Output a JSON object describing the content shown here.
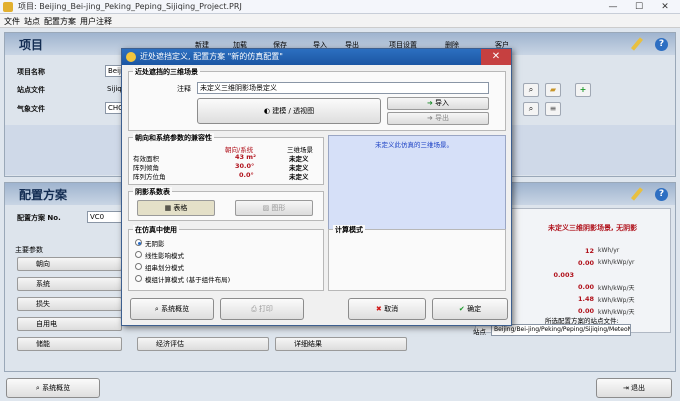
{
  "window": {
    "title": "项目: Beijing_Bei-jing_Peking_Peping_Sijiqing_Project.PRJ"
  },
  "menu": [
    "文件",
    "站点",
    "配置方案",
    "用户注释"
  ],
  "project": {
    "section_title": "项目",
    "toolbar": {
      "new": "新建",
      "load": "加载",
      "save": "保存",
      "import": "导入",
      "export": "导出",
      "settings": "项目设置",
      "delete": "删除",
      "client": "客户"
    },
    "name_label": "项目名称",
    "name_value": "Beiji",
    "site_label": "站点文件",
    "site_value": "Sijiq",
    "meteo_label": "气象文件",
    "meteo_value": "CHC"
  },
  "config": {
    "section_title": "配置方案",
    "no_label": "配置方案 No.",
    "no_value": "VC0",
    "main_params_label": "主要参数",
    "params": [
      "朝向",
      "系统",
      "损失",
      "自用电",
      "储能"
    ],
    "mid_buttons": [
      "经济评估",
      "详细结果"
    ],
    "right_title": "未定义三维阴影场景, 无阴影",
    "results": [
      {
        "value": "12",
        "unit": "kWh/yr"
      },
      {
        "value": "0.00",
        "unit": "kWh/kWp/yr"
      },
      {
        "value": "0.003",
        "unit": ""
      },
      {
        "value": "0.00",
        "unit": "kWh/kWp/天"
      },
      {
        "value": "1.48",
        "unit": "kWh/kWp/天"
      },
      {
        "value": "0.00",
        "unit": "kWh/kWp/天"
      }
    ],
    "site_files_label": "所选配置方案的站点文件:",
    "site_label": "站点",
    "site_path": "Beijing/Bei-jing/Peking/Peping/Sijiqing/MeteoNorm 8.1"
  },
  "bottom": {
    "overview": "系统概览",
    "exit": "退出"
  },
  "dialog": {
    "title": "近处遮挡定义, 配置方案 \"新的仿真配置\"",
    "scene_group": "近处遮挡的三维场景",
    "comment_label": "注释",
    "comment_value": "未定义三维阴影场景定义",
    "build_btn": "建模 / 透视图",
    "import_btn": "导入",
    "export_btn": "导出",
    "orient_group": "朝向和系统参数的兼容性",
    "col_orient": "朝向/系统",
    "col_scene": "三维场景",
    "rows": [
      {
        "label": "有效面积",
        "orient": "43 m²",
        "scene": "未定义"
      },
      {
        "label": "阵列倾角",
        "orient": "30.0°",
        "scene": "未定义"
      },
      {
        "label": "阵列方位角",
        "orient": "0.0°",
        "scene": "未定义"
      }
    ],
    "scene_status": "未定义此仿真的三维场景。",
    "shade_group": "阴影系数表",
    "table_btn": "表格",
    "graph_btn": "图形",
    "sim_group": "在仿真中使用",
    "options": [
      "无阴影",
      "线性影响模式",
      "组串划分模式",
      "模组计算模式 (基于组件布局)"
    ],
    "calc_group": "计算模式",
    "overview_btn": "系统概览",
    "print_btn": "打印",
    "cancel_btn": "取消",
    "ok_btn": "确定"
  }
}
